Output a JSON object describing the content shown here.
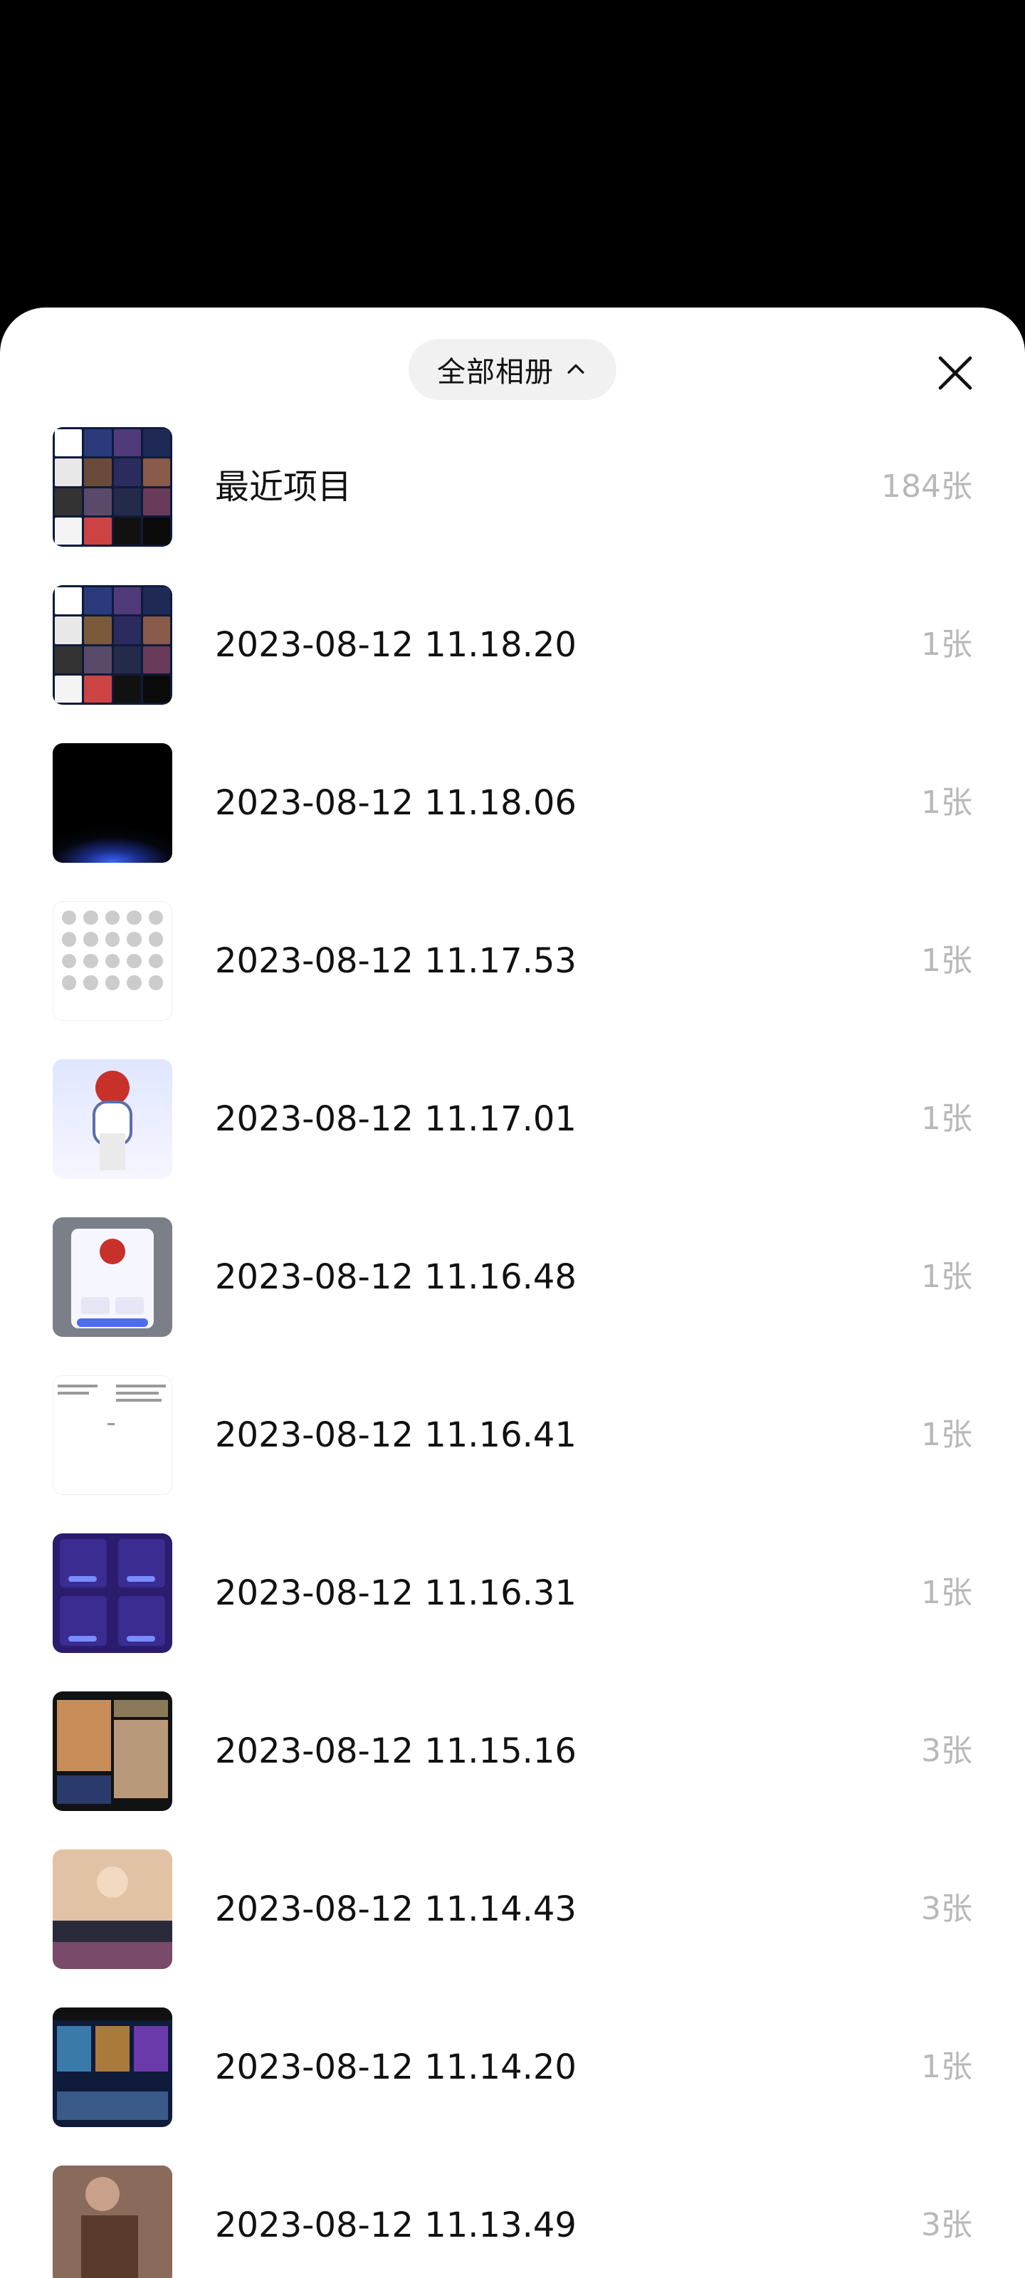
{
  "header": {
    "album_switch_label": "全部相册",
    "album_switch_icon": "chevron-up-icon",
    "close_icon": "close-icon"
  },
  "albums": [
    {
      "title": "最近项目",
      "count": "184张",
      "thumb": "mosaic"
    },
    {
      "title": "2023-08-12 11.18.20",
      "count": "1张",
      "thumb": "mosaic"
    },
    {
      "title": "2023-08-12 11.18.06",
      "count": "1张",
      "thumb": "dark-glow"
    },
    {
      "title": "2023-08-12 11.17.53",
      "count": "1张",
      "thumb": "icon-grid"
    },
    {
      "title": "2023-08-12 11.17.01",
      "count": "1张",
      "thumb": "avatar"
    },
    {
      "title": "2023-08-12 11.16.48",
      "count": "1张",
      "thumb": "popup"
    },
    {
      "title": "2023-08-12 11.16.41",
      "count": "1张",
      "thumb": "text-doc"
    },
    {
      "title": "2023-08-12 11.16.31",
      "count": "1张",
      "thumb": "purple-cards"
    },
    {
      "title": "2023-08-12 11.15.16",
      "count": "3张",
      "thumb": "photo-collage"
    },
    {
      "title": "2023-08-12 11.14.43",
      "count": "3张",
      "thumb": "photo-portrait"
    },
    {
      "title": "2023-08-12 11.14.20",
      "count": "1张",
      "thumb": "movie-grid"
    },
    {
      "title": "2023-08-12 11.13.49",
      "count": "3张",
      "thumb": "photo-brown"
    }
  ],
  "colors": {
    "sheet_bg": "#ffffff",
    "title_text": "#111111",
    "count_text": "#b8b8b8",
    "pill_bg": "#f1f1f1",
    "backdrop": "#000000"
  }
}
